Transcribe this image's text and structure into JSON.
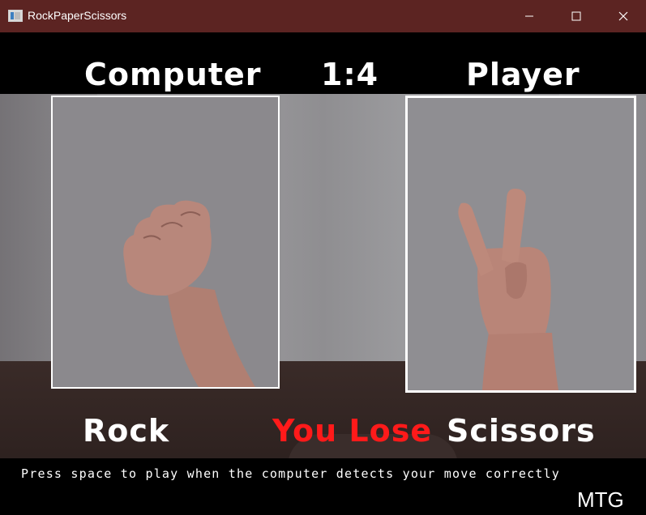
{
  "window": {
    "title": "RockPaperScissors",
    "icons": [
      "app-icon",
      "minimize-icon",
      "maximize-icon",
      "close-icon"
    ]
  },
  "game": {
    "computer_label": "Computer",
    "score": "1:4",
    "player_label": "Player",
    "computer_move": "Rock",
    "result": "You Lose",
    "player_move": "Scissors",
    "instructions": "Press space to play when the computer detects your move correctly",
    "watermark": "MTG",
    "colors": {
      "result": "#ff1a1a",
      "titlebar": "#5c2422",
      "text": "#ffffff"
    }
  }
}
